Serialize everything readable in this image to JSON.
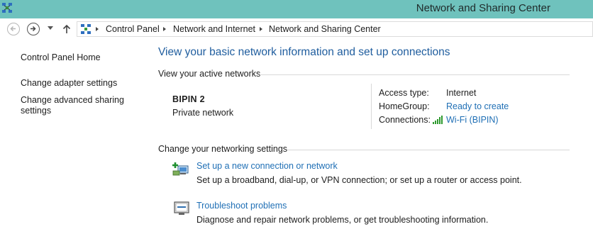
{
  "window": {
    "title": "Network and Sharing Center"
  },
  "navigation": {
    "breadcrumbs": [
      "Control Panel",
      "Network and Internet",
      "Network and Sharing Center"
    ]
  },
  "sidebar": {
    "items": [
      {
        "label": "Control Panel Home"
      },
      {
        "label": "Change adapter settings"
      },
      {
        "label": "Change advanced sharing settings"
      }
    ]
  },
  "main": {
    "title": "View your basic network information and set up connections",
    "active_networks": {
      "heading": "View your active networks",
      "network_name": "BIPIN  2",
      "network_type": "Private network",
      "details": [
        {
          "label": "Access type:",
          "value": "Internet",
          "is_link": false
        },
        {
          "label": "HomeGroup:",
          "value": "Ready to create",
          "is_link": true
        },
        {
          "label": "Connections:",
          "value": "Wi-Fi (BIPIN)",
          "is_link": true,
          "icon": "wifi-signal-icon"
        }
      ]
    },
    "settings": {
      "heading": "Change your networking settings",
      "tasks": [
        {
          "link": "Set up a new connection or network",
          "description": "Set up a broadband, dial-up, or VPN connection; or set up a router or access point.",
          "icon": "new-connection-icon"
        },
        {
          "link": "Troubleshoot problems",
          "description": "Diagnose and repair network problems, or get troubleshooting information.",
          "icon": "troubleshoot-icon"
        }
      ]
    }
  },
  "colors": {
    "titlebar": "#6fc2bd",
    "link": "#1f6fb5",
    "heading": "#1f5d9e"
  }
}
